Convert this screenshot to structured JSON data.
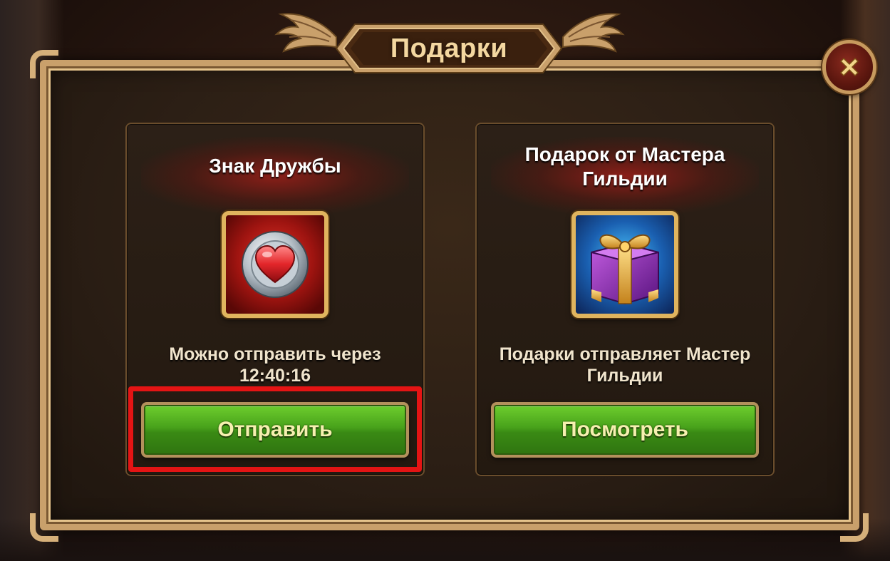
{
  "window": {
    "title": "Подарки"
  },
  "close_button": {
    "icon": "close-icon"
  },
  "cards": [
    {
      "title": "Знак Дружбы",
      "icon": "heart-token-icon",
      "description_line1": "Можно отправить через",
      "description_line2": "12:40:16",
      "button_label": "Отправить"
    },
    {
      "title_line1": "Подарок от Мастера",
      "title_line2": "Гильдии",
      "icon": "gift-box-icon",
      "description_line1": "Подарки отправляет Мастер",
      "description_line2": "Гильдии",
      "button_label": "Посмотреть"
    }
  ],
  "colors": {
    "accent_gold": "#e0b45e",
    "button_green": "#48a21b",
    "highlight_red": "#e41414",
    "panel_dark": "#2c1f15"
  }
}
